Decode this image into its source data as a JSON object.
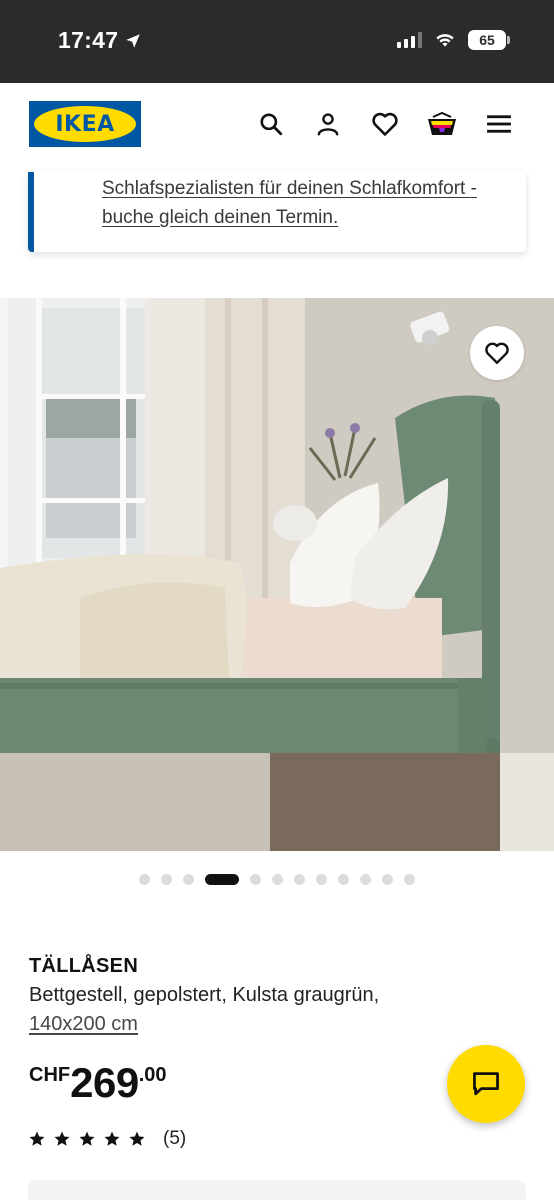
{
  "status_bar": {
    "time": "17:47",
    "battery": "65",
    "location_icon": "location-arrow-icon",
    "wifi_icon": "wifi-icon",
    "signal_icon": "cellular-signal-icon"
  },
  "header": {
    "logo_text": "IKEA",
    "icons": [
      "search-icon",
      "profile-icon",
      "heart-icon",
      "shopping-basket-icon",
      "menu-icon"
    ],
    "brand_colors": {
      "blue": "#0058a3",
      "yellow": "#ffdb00"
    }
  },
  "banner": {
    "link_text": "Schlafspezialisten für deinen Schlafkomfort - buche gleich deinen Termin."
  },
  "gallery": {
    "image_alt": "",
    "favourite_icon": "heart-icon",
    "dots_total": 12,
    "active_index": 3
  },
  "product": {
    "name": "TÄLLÅSEN",
    "description": "Bettgestell, gepolstert, Kulsta graugrün,",
    "size": "140x200 cm",
    "price_currency": "CHF",
    "price_main": "269",
    "price_cents": ".00",
    "rating_stars": 5,
    "rating_count": "(5)"
  },
  "chat": {
    "icon": "chat-bubble-icon"
  }
}
